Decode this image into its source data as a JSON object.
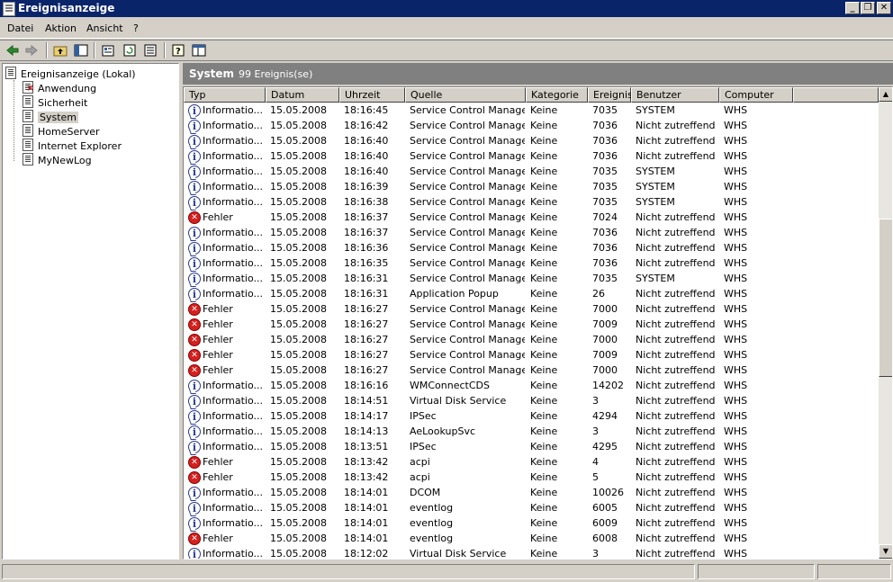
{
  "window": {
    "title": "Ereignisanzeige"
  },
  "menu": [
    "Datei",
    "Aktion",
    "Ansicht",
    "?"
  ],
  "tree": {
    "root": "Ereignisanzeige (Lokal)",
    "items": [
      "Anwendung",
      "Sicherheit",
      "System",
      "HomeServer",
      "Internet Explorer",
      "MyNewLog"
    ],
    "selected": "System"
  },
  "panel": {
    "title": "System",
    "count": "99 Ereignis(se)"
  },
  "columns": [
    "Typ",
    "Datum",
    "Uhrzeit",
    "Quelle",
    "Kategorie",
    "Ereignis",
    "Benutzer",
    "Computer"
  ],
  "events": [
    {
      "icon": "info",
      "type": "Informatio...",
      "date": "15.05.2008",
      "time": "18:16:45",
      "source": "Service Control Manager",
      "category": "Keine",
      "event": "7035",
      "user": "SYSTEM",
      "computer": "WHS"
    },
    {
      "icon": "info",
      "type": "Informatio...",
      "date": "15.05.2008",
      "time": "18:16:42",
      "source": "Service Control Manager",
      "category": "Keine",
      "event": "7036",
      "user": "Nicht zutreffend",
      "computer": "WHS"
    },
    {
      "icon": "info",
      "type": "Informatio...",
      "date": "15.05.2008",
      "time": "18:16:40",
      "source": "Service Control Manager",
      "category": "Keine",
      "event": "7036",
      "user": "Nicht zutreffend",
      "computer": "WHS"
    },
    {
      "icon": "info",
      "type": "Informatio...",
      "date": "15.05.2008",
      "time": "18:16:40",
      "source": "Service Control Manager",
      "category": "Keine",
      "event": "7036",
      "user": "Nicht zutreffend",
      "computer": "WHS"
    },
    {
      "icon": "info",
      "type": "Informatio...",
      "date": "15.05.2008",
      "time": "18:16:40",
      "source": "Service Control Manager",
      "category": "Keine",
      "event": "7035",
      "user": "SYSTEM",
      "computer": "WHS"
    },
    {
      "icon": "info",
      "type": "Informatio...",
      "date": "15.05.2008",
      "time": "18:16:39",
      "source": "Service Control Manager",
      "category": "Keine",
      "event": "7035",
      "user": "SYSTEM",
      "computer": "WHS"
    },
    {
      "icon": "info",
      "type": "Informatio...",
      "date": "15.05.2008",
      "time": "18:16:38",
      "source": "Service Control Manager",
      "category": "Keine",
      "event": "7035",
      "user": "SYSTEM",
      "computer": "WHS"
    },
    {
      "icon": "error",
      "type": "Fehler",
      "date": "15.05.2008",
      "time": "18:16:37",
      "source": "Service Control Manager",
      "category": "Keine",
      "event": "7024",
      "user": "Nicht zutreffend",
      "computer": "WHS"
    },
    {
      "icon": "info",
      "type": "Informatio...",
      "date": "15.05.2008",
      "time": "18:16:37",
      "source": "Service Control Manager",
      "category": "Keine",
      "event": "7036",
      "user": "Nicht zutreffend",
      "computer": "WHS"
    },
    {
      "icon": "info",
      "type": "Informatio...",
      "date": "15.05.2008",
      "time": "18:16:36",
      "source": "Service Control Manager",
      "category": "Keine",
      "event": "7036",
      "user": "Nicht zutreffend",
      "computer": "WHS"
    },
    {
      "icon": "info",
      "type": "Informatio...",
      "date": "15.05.2008",
      "time": "18:16:35",
      "source": "Service Control Manager",
      "category": "Keine",
      "event": "7036",
      "user": "Nicht zutreffend",
      "computer": "WHS"
    },
    {
      "icon": "info",
      "type": "Informatio...",
      "date": "15.05.2008",
      "time": "18:16:31",
      "source": "Service Control Manager",
      "category": "Keine",
      "event": "7035",
      "user": "SYSTEM",
      "computer": "WHS"
    },
    {
      "icon": "info",
      "type": "Informatio...",
      "date": "15.05.2008",
      "time": "18:16:31",
      "source": "Application Popup",
      "category": "Keine",
      "event": "26",
      "user": "Nicht zutreffend",
      "computer": "WHS"
    },
    {
      "icon": "error",
      "type": "Fehler",
      "date": "15.05.2008",
      "time": "18:16:27",
      "source": "Service Control Manager",
      "category": "Keine",
      "event": "7000",
      "user": "Nicht zutreffend",
      "computer": "WHS"
    },
    {
      "icon": "error",
      "type": "Fehler",
      "date": "15.05.2008",
      "time": "18:16:27",
      "source": "Service Control Manager",
      "category": "Keine",
      "event": "7009",
      "user": "Nicht zutreffend",
      "computer": "WHS"
    },
    {
      "icon": "error",
      "type": "Fehler",
      "date": "15.05.2008",
      "time": "18:16:27",
      "source": "Service Control Manager",
      "category": "Keine",
      "event": "7000",
      "user": "Nicht zutreffend",
      "computer": "WHS"
    },
    {
      "icon": "error",
      "type": "Fehler",
      "date": "15.05.2008",
      "time": "18:16:27",
      "source": "Service Control Manager",
      "category": "Keine",
      "event": "7009",
      "user": "Nicht zutreffend",
      "computer": "WHS"
    },
    {
      "icon": "error",
      "type": "Fehler",
      "date": "15.05.2008",
      "time": "18:16:27",
      "source": "Service Control Manager",
      "category": "Keine",
      "event": "7000",
      "user": "Nicht zutreffend",
      "computer": "WHS"
    },
    {
      "icon": "info",
      "type": "Informatio...",
      "date": "15.05.2008",
      "time": "18:16:16",
      "source": "WMConnectCDS",
      "category": "Keine",
      "event": "14202",
      "user": "Nicht zutreffend",
      "computer": "WHS"
    },
    {
      "icon": "info",
      "type": "Informatio...",
      "date": "15.05.2008",
      "time": "18:14:51",
      "source": "Virtual Disk Service",
      "category": "Keine",
      "event": "3",
      "user": "Nicht zutreffend",
      "computer": "WHS"
    },
    {
      "icon": "info",
      "type": "Informatio...",
      "date": "15.05.2008",
      "time": "18:14:17",
      "source": "IPSec",
      "category": "Keine",
      "event": "4294",
      "user": "Nicht zutreffend",
      "computer": "WHS"
    },
    {
      "icon": "info",
      "type": "Informatio...",
      "date": "15.05.2008",
      "time": "18:14:13",
      "source": "AeLookupSvc",
      "category": "Keine",
      "event": "3",
      "user": "Nicht zutreffend",
      "computer": "WHS"
    },
    {
      "icon": "info",
      "type": "Informatio...",
      "date": "15.05.2008",
      "time": "18:13:51",
      "source": "IPSec",
      "category": "Keine",
      "event": "4295",
      "user": "Nicht zutreffend",
      "computer": "WHS"
    },
    {
      "icon": "error",
      "type": "Fehler",
      "date": "15.05.2008",
      "time": "18:13:42",
      "source": "acpi",
      "category": "Keine",
      "event": "4",
      "user": "Nicht zutreffend",
      "computer": "WHS"
    },
    {
      "icon": "error",
      "type": "Fehler",
      "date": "15.05.2008",
      "time": "18:13:42",
      "source": "acpi",
      "category": "Keine",
      "event": "5",
      "user": "Nicht zutreffend",
      "computer": "WHS"
    },
    {
      "icon": "info",
      "type": "Informatio...",
      "date": "15.05.2008",
      "time": "18:14:01",
      "source": "DCOM",
      "category": "Keine",
      "event": "10026",
      "user": "Nicht zutreffend",
      "computer": "WHS"
    },
    {
      "icon": "info",
      "type": "Informatio...",
      "date": "15.05.2008",
      "time": "18:14:01",
      "source": "eventlog",
      "category": "Keine",
      "event": "6005",
      "user": "Nicht zutreffend",
      "computer": "WHS"
    },
    {
      "icon": "info",
      "type": "Informatio...",
      "date": "15.05.2008",
      "time": "18:14:01",
      "source": "eventlog",
      "category": "Keine",
      "event": "6009",
      "user": "Nicht zutreffend",
      "computer": "WHS"
    },
    {
      "icon": "error",
      "type": "Fehler",
      "date": "15.05.2008",
      "time": "18:14:01",
      "source": "eventlog",
      "category": "Keine",
      "event": "6008",
      "user": "Nicht zutreffend",
      "computer": "WHS"
    },
    {
      "icon": "info",
      "type": "Informatio...",
      "date": "15.05.2008",
      "time": "18:12:02",
      "source": "Virtual Disk Service",
      "category": "Keine",
      "event": "3",
      "user": "Nicht zutreffend",
      "computer": "WHS"
    }
  ]
}
